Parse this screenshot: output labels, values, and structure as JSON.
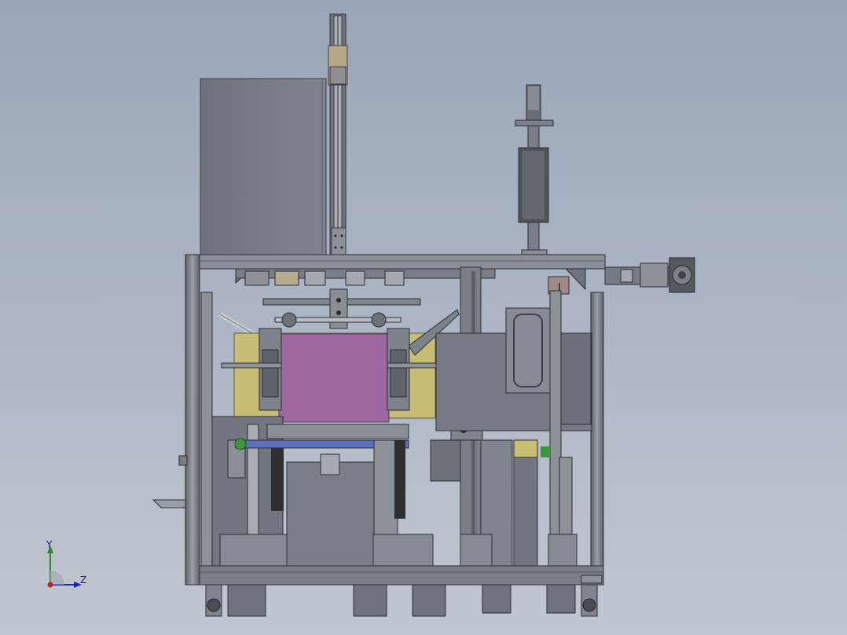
{
  "viewport": {
    "background_top": "#9aa6b8",
    "background_bottom": "#c1c7d0"
  },
  "colors": {
    "frame": "#7c8088",
    "frame_dark": "#55595f",
    "frame_light": "#a2a6ad",
    "panel": "#787d86",
    "magenta": "#9f67a0",
    "yellow": "#c9bf73",
    "blue": "#5f6fbf",
    "green": "#3a9a3a",
    "red": "#c03030"
  },
  "triad": {
    "y_label": "Y",
    "z_label": "Z",
    "y_axis_color": "#2a8a2a",
    "z_axis_color": "#2323b8",
    "origin_color": "#c02020"
  }
}
